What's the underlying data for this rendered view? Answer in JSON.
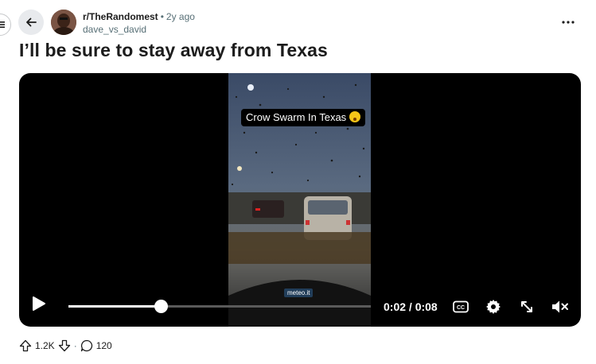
{
  "post": {
    "subreddit": "r/TheRandomest",
    "age": "2y ago",
    "author": "dave_vs_david",
    "title": "I’ll be sure to stay away from Texas"
  },
  "video": {
    "caption": "Crow Swarm In Texas",
    "watermark": "meteo.it",
    "time_display": "0:02 / 0:08",
    "progress": 0.305,
    "muted": true
  },
  "actions": {
    "upvotes": "1.2K",
    "comments": "120"
  },
  "icons": [
    "menu-icon",
    "back-arrow-icon",
    "more-icon",
    "play-icon",
    "captions-icon",
    "settings-icon",
    "fullscreen-icon",
    "mute-icon",
    "upvote-icon",
    "downvote-icon",
    "comment-icon"
  ]
}
